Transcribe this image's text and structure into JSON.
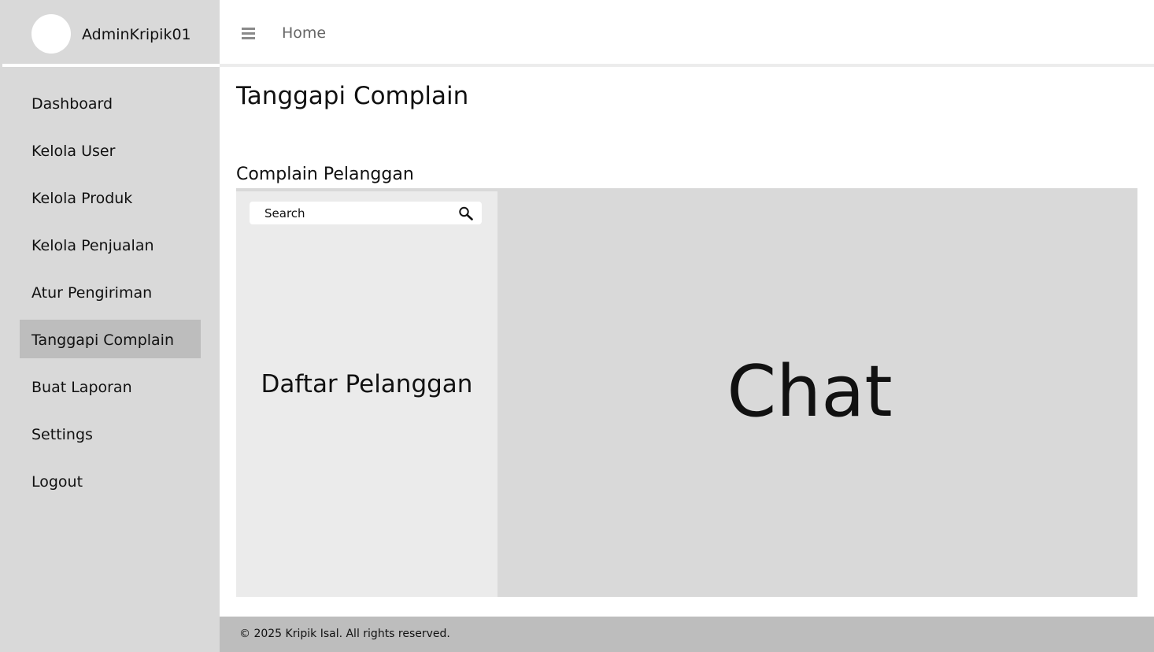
{
  "sidebar": {
    "username": "AdminKripik01",
    "active_item": "Tanggapi Complain",
    "items": [
      {
        "label": "Dashboard"
      },
      {
        "label": "Kelola User"
      },
      {
        "label": "Kelola Produk"
      },
      {
        "label": "Kelola Penjualan"
      },
      {
        "label": "Atur Pengiriman"
      },
      {
        "label": "Tanggapi Complain"
      },
      {
        "label": "Buat Laporan"
      },
      {
        "label": "Settings"
      },
      {
        "label": "Logout"
      }
    ]
  },
  "topbar": {
    "menu_icon": "hamburger-menu-icon",
    "breadcrumb": "Home"
  },
  "main": {
    "title": "Tanggapi Complain",
    "section_title": "Complain Pelanggan",
    "search": {
      "placeholder": "Search",
      "value": "",
      "icon": "search-icon"
    },
    "customer_list_label": "Daftar Pelanggan",
    "chat_label": "Chat"
  },
  "footer": {
    "text": "© 2025 Kripik Isal. All rights reserved."
  },
  "colors": {
    "sidebar_bg": "#d9d9d9",
    "active_item_bg": "#bdbdbd",
    "footer_bg": "#bdbdbd",
    "list_bg": "#ebebeb",
    "chat_bg": "#d9d9d9"
  }
}
